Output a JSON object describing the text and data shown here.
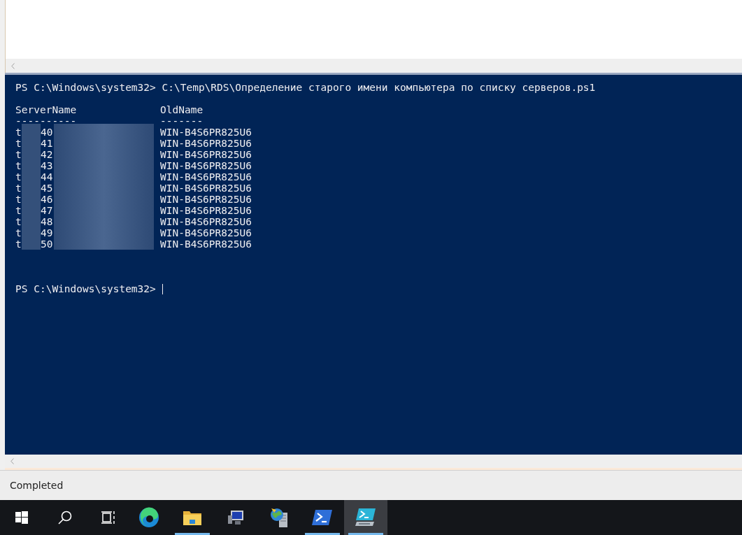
{
  "console": {
    "command_line": {
      "prompt": "PS C:\\Windows\\system32>",
      "command": "C:\\Temp\\RDS\\Определение старого имени компьютера по списку серверов.ps1"
    },
    "table": {
      "columns": [
        {
          "header": "ServerName",
          "underline": "----------"
        },
        {
          "header": "OldName",
          "underline": "-------"
        }
      ],
      "rows": [
        {
          "server_prefix": "t",
          "server_number": "40",
          "old_name": "WIN-B4S6PR825U6"
        },
        {
          "server_prefix": "t",
          "server_number": "41",
          "old_name": "WIN-B4S6PR825U6"
        },
        {
          "server_prefix": "t",
          "server_number": "42",
          "old_name": "WIN-B4S6PR825U6"
        },
        {
          "server_prefix": "t",
          "server_number": "43",
          "old_name": "WIN-B4S6PR825U6"
        },
        {
          "server_prefix": "t",
          "server_number": "44",
          "old_name": "WIN-B4S6PR825U6"
        },
        {
          "server_prefix": "t",
          "server_number": "45",
          "old_name": "WIN-B4S6PR825U6"
        },
        {
          "server_prefix": "t",
          "server_number": "46",
          "old_name": "WIN-B4S6PR825U6"
        },
        {
          "server_prefix": "t",
          "server_number": "47",
          "old_name": "WIN-B4S6PR825U6"
        },
        {
          "server_prefix": "t",
          "server_number": "48",
          "old_name": "WIN-B4S6PR825U6"
        },
        {
          "server_prefix": "t",
          "server_number": "49",
          "old_name": "WIN-B4S6PR825U6"
        },
        {
          "server_prefix": "t",
          "server_number": "50",
          "old_name": "WIN-B4S6PR825U6"
        }
      ]
    },
    "current_prompt": "PS C:\\Windows\\system32>"
  },
  "status_bar": {
    "text": "Completed"
  },
  "taskbar": {
    "items": [
      {
        "kind": "start",
        "running": false,
        "selected": false
      },
      {
        "kind": "search",
        "running": false,
        "selected": false
      },
      {
        "kind": "taskview",
        "running": false,
        "selected": false
      },
      {
        "kind": "edge",
        "running": false,
        "selected": false
      },
      {
        "kind": "explorer",
        "running": true,
        "selected": false
      },
      {
        "kind": "computer",
        "running": false,
        "selected": false
      },
      {
        "kind": "server",
        "running": false,
        "selected": false
      },
      {
        "kind": "powershell",
        "running": true,
        "selected": false
      },
      {
        "kind": "ise",
        "running": true,
        "selected": true
      }
    ]
  }
}
